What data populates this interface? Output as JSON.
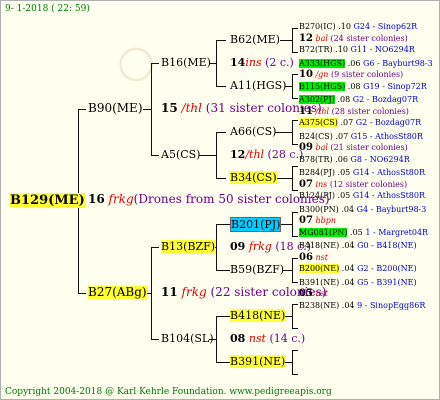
{
  "header": {
    "date": "9-  1-2018 ( 22: 59)"
  },
  "footer": {
    "copyright": "Copyright 2004-2018 @ Karl Kehrle Foundation.",
    "site": "www.pedigreeapis.org"
  },
  "root": {
    "id": "B129(ME)"
  },
  "drones_root": {
    "num": "16",
    "sym": "frkg",
    "text": "(Drones from 50 sister colonies)"
  },
  "g1": {
    "top": {
      "id": "B90(ME)"
    },
    "top_drones": {
      "num": "15",
      "sym": "/thl",
      "text": "(31 sister colonies)"
    },
    "bot": {
      "id": "B27(ABg)"
    },
    "bot_drones": {
      "num": "11",
      "sym": "frkg",
      "text": "(22 sister colonies)"
    }
  },
  "g2": [
    {
      "id": "B16(ME)",
      "dnum": "14",
      "dsym": "ins",
      "dtext": "(2 c.)",
      "q": {
        "id": "B62(ME)"
      },
      "d": {
        "id": "A11(HGS)"
      }
    },
    {
      "id": "A5(CS)",
      "dnum": "12",
      "dsym": "/thl",
      "dtext": "(28 c.)",
      "q": {
        "id": "A66(CS)"
      },
      "d": {
        "id": "B34(CS)"
      }
    },
    {
      "id": "B13(BZF)",
      "dnum": "09",
      "dsym": "frkg",
      "dtext": "(18 c.)",
      "q": {
        "id": "B201(PJ)"
      },
      "d": {
        "id": "B59(BZF)"
      }
    },
    {
      "id": "B104(SL)",
      "dnum": "08",
      "dsym": "nst",
      "dtext": "(14 c.)",
      "q": {
        "id": "B418(NE)"
      },
      "d": {
        "id": "B391(NE)"
      }
    }
  ],
  "g4": [
    {
      "id": "B270(IC)",
      "v": ".10",
      "src": "G24 - Sinop62R"
    },
    {
      "num": "12",
      "sym": "bal",
      "text": "(24 sister colonies)"
    },
    {
      "id": "B72(TR)",
      "v": ".10",
      "src": "G11 - NO6294R"
    },
    {
      "id": "A333(HGS)",
      "v": ".06",
      "src": "G6 - Bayburt98-3"
    },
    {
      "num": "10",
      "sym": "/gn",
      "text": "(9 sister colonies)"
    },
    {
      "id": "B115(HGS)",
      "v": ".08",
      "src": "G19 - Sinop72R"
    },
    {
      "id": "A302(PJ)",
      "v": ".08",
      "src": "G2 - Bozdag07R"
    },
    {
      "num": "11",
      "sym": "/thl",
      "text": "(28 sister colonies)"
    },
    {
      "id": "A375(CS)",
      "v": ".07",
      "src": "G2 - Bozdag07R"
    },
    {
      "id": "B24(CS)",
      "v": ".07",
      "src": "G15 - AthosSt80R"
    },
    {
      "num": "09",
      "sym": "bal",
      "text": "(21 sister colonies)"
    },
    {
      "id": "B78(TR)",
      "v": ".06",
      "src": "G8 - NO6294R"
    },
    {
      "id": "B284(PJ)",
      "v": ".05",
      "src": "G14 - AthosSt80R"
    },
    {
      "num": "07",
      "sym": "ins",
      "text": "(12 sister colonies)"
    },
    {
      "id": "B124(PJ)",
      "v": ".05",
      "src": "G14 - AthosSt80R"
    },
    {
      "id": "B300(PN)",
      "v": ".04",
      "src": "G4 - Bayburt98-3"
    },
    {
      "num": "07",
      "sym": "hbpn",
      "text": ""
    },
    {
      "id": "MG081(PN)",
      "v": ".05",
      "src": "1 - Margret04R"
    },
    {
      "id": "B418(NE)",
      "v": ".04",
      "src": "G0 - B418(NE)"
    },
    {
      "num": "06",
      "sym": "nst",
      "text": ""
    },
    {
      "id": "B200(NE)",
      "v": ".04",
      "src": "G2 - B200(NE)"
    },
    {
      "id": "B391(NE)",
      "v": ".04",
      "src": "G5 - B391(NE)"
    },
    {
      "num": "05",
      "sym": "nst",
      "text": ""
    },
    {
      "id": "B238(NE)",
      "v": ".04",
      "src": "9 - SinopEgg86R"
    }
  ],
  "colors": {
    "yellow": "#ffff33",
    "green": "#00ee00",
    "cyan": "#00ccff",
    "red": "#dd0000",
    "purple": "#6a008a",
    "blue": "#0000cc",
    "header_green": "#007700"
  }
}
